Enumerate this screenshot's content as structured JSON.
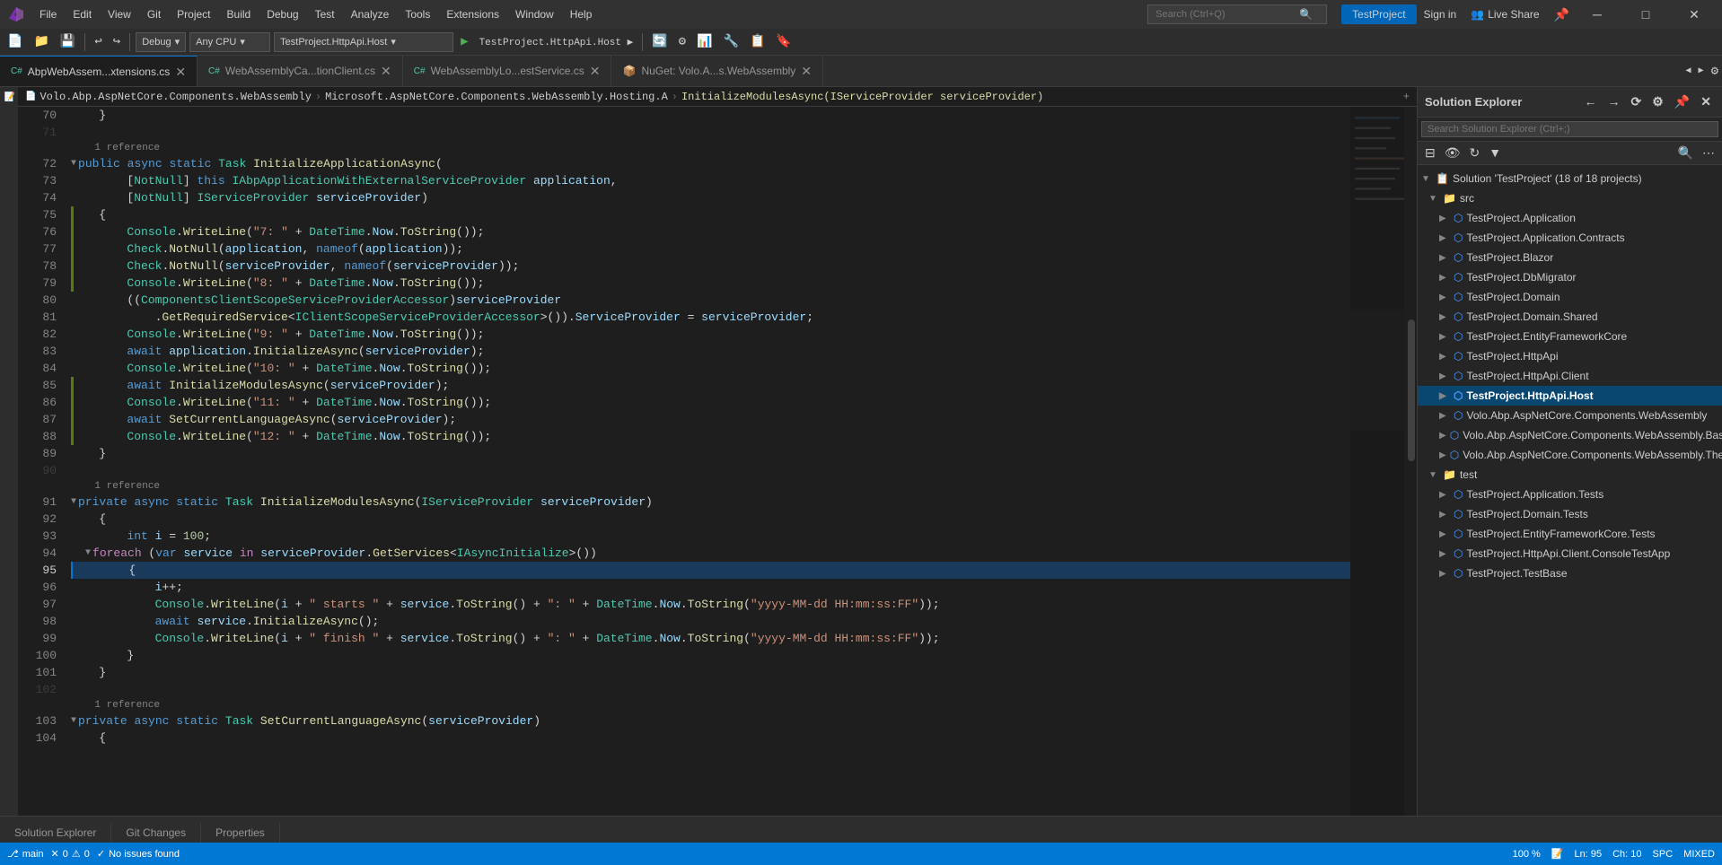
{
  "titlebar": {
    "menus": [
      "File",
      "Edit",
      "View",
      "Git",
      "Project",
      "Build",
      "Debug",
      "Test",
      "Analyze",
      "Tools",
      "Extensions",
      "Window",
      "Help"
    ],
    "search_placeholder": "Search (Ctrl+Q)",
    "project_name": "TestProject",
    "sign_in": "Sign in",
    "live_share": "Live Share"
  },
  "toolbar": {
    "debug_config": "Debug",
    "platform": "Any CPU",
    "startup_project": "TestProject.HttpApi.Host"
  },
  "tabs": [
    {
      "label": "AbpWebAssem...xtensions.cs",
      "active": true,
      "modified": false
    },
    {
      "label": "WebAssemblyCa...tionClient.cs",
      "active": false,
      "modified": false
    },
    {
      "label": "WebAssemblyLo...estService.cs",
      "active": false,
      "modified": false
    },
    {
      "label": "NuGet: Volo.A...s.WebAssembly",
      "active": false,
      "modified": false
    }
  ],
  "breadcrumb": {
    "parts": [
      "Volo.Abp.AspNetCore.Components.WebAssembly",
      "Microsoft.AspNetCore.Components.WebAssembly.Hosting.A",
      "InitializeModulesAsync(IServiceProvider serviceProvider)"
    ]
  },
  "code": {
    "lines": [
      {
        "num": "70",
        "content": "    }",
        "indent": 4
      },
      {
        "num": "",
        "content": ""
      },
      {
        "num": "72",
        "content": "    public async static Task InitializeApplicationAsync(",
        "hasRef": true,
        "refText": "1 reference"
      },
      {
        "num": "73",
        "content": "        [NotNull] this IAbpApplicationWithExternalServiceProvider application,"
      },
      {
        "num": "74",
        "content": "        [NotNull] IServiceProvider serviceProvider)"
      },
      {
        "num": "75",
        "content": "    {",
        "collapsible": true
      },
      {
        "num": "76",
        "content": "        Console.WriteLine(\"7: \" + DateTime.Now.ToString());"
      },
      {
        "num": "77",
        "content": "        Check.NotNull(application, nameof(application));"
      },
      {
        "num": "78",
        "content": "        Check.NotNull(serviceProvider, nameof(serviceProvider));"
      },
      {
        "num": "79",
        "content": "        Console.WriteLine(\"8: \" + DateTime.Now.ToString());"
      },
      {
        "num": "80",
        "content": "        ((ComponentsClientScopeServiceProviderAccessor)serviceProvider"
      },
      {
        "num": "81",
        "content": "            .GetRequiredService<IClientScopeServiceProviderAccessor>()).ServiceProvider = serviceProvider;"
      },
      {
        "num": "82",
        "content": "        Console.WriteLine(\"9: \" + DateTime.Now.ToString());"
      },
      {
        "num": "83",
        "content": "        await application.InitializeAsync(serviceProvider);"
      },
      {
        "num": "84",
        "content": "        Console.WriteLine(\"10: \" + DateTime.Now.ToString());"
      },
      {
        "num": "85",
        "content": "        await InitializeModulesAsync(serviceProvider);"
      },
      {
        "num": "86",
        "content": "        Console.WriteLine(\"11: \" + DateTime.Now.ToString());"
      },
      {
        "num": "87",
        "content": "        await SetCurrentLanguageAsync(serviceProvider);"
      },
      {
        "num": "88",
        "content": "        Console.WriteLine(\"12: \" + DateTime.Now.ToString());"
      },
      {
        "num": "89",
        "content": "    }"
      },
      {
        "num": "90",
        "content": ""
      },
      {
        "num": "91",
        "content": "    private async static Task InitializeModulesAsync(IServiceProvider serviceProvider)",
        "hasRef": true,
        "refText": "1 reference"
      },
      {
        "num": "92",
        "content": "    {",
        "collapsible": true
      },
      {
        "num": "93",
        "content": "        int i = 100;"
      },
      {
        "num": "94",
        "content": "        foreach (var service in serviceProvider.GetServices<IAsyncInitialize>())",
        "collapsible": true
      },
      {
        "num": "95",
        "content": "        {",
        "current": true
      },
      {
        "num": "96",
        "content": "            i++;"
      },
      {
        "num": "97",
        "content": "            Console.WriteLine(i + \" starts \" + service.ToString() + \": \" + DateTime.Now.ToString(\"yyyy-MM-dd HH:mm:ss:FF\"));"
      },
      {
        "num": "98",
        "content": "            await service.InitializeAsync();"
      },
      {
        "num": "99",
        "content": "            Console.WriteLine(i + \" finish \" + service.ToString() + \": \" + DateTime.Now.ToString(\"yyyy-MM-dd HH:mm:ss:FF\"));"
      },
      {
        "num": "100",
        "content": "        }"
      },
      {
        "num": "101",
        "content": "    }"
      },
      {
        "num": "102",
        "content": ""
      },
      {
        "num": "103",
        "content": "    private async static Task SetCurrentLanguageAsync(serviceProvider)",
        "hasRef": true,
        "refText": "1 reference"
      },
      {
        "num": "104",
        "content": "    {"
      }
    ]
  },
  "solution_explorer": {
    "title": "Solution Explorer",
    "search_placeholder": "Search Solution Explorer (Ctrl+;)",
    "solution_name": "Solution 'TestProject' (18 of 18 projects)",
    "items": [
      {
        "label": "src",
        "type": "folder",
        "indent": 1,
        "expanded": true
      },
      {
        "label": "TestProject.Application",
        "type": "project",
        "indent": 2
      },
      {
        "label": "TestProject.Application.Contracts",
        "type": "project",
        "indent": 2
      },
      {
        "label": "TestProject.Blazor",
        "type": "project",
        "indent": 2
      },
      {
        "label": "TestProject.DbMigrator",
        "type": "project",
        "indent": 2
      },
      {
        "label": "TestProject.Domain",
        "type": "project",
        "indent": 2
      },
      {
        "label": "TestProject.Domain.Shared",
        "type": "project",
        "indent": 2
      },
      {
        "label": "TestProject.EntityFrameworkCore",
        "type": "project",
        "indent": 2
      },
      {
        "label": "TestProject.HttpApi",
        "type": "project",
        "indent": 2
      },
      {
        "label": "TestProject.HttpApi.Client",
        "type": "project",
        "indent": 2
      },
      {
        "label": "TestProject.HttpApi.Host",
        "type": "project",
        "indent": 2,
        "active": true
      },
      {
        "label": "Volo.Abp.AspNetCore.Components.WebAssembly",
        "type": "project",
        "indent": 2
      },
      {
        "label": "Volo.Abp.AspNetCore.Components.WebAssembly.BasicTheme",
        "type": "project",
        "indent": 2
      },
      {
        "label": "Volo.Abp.AspNetCore.Components.WebAssembly.Theming",
        "type": "project",
        "indent": 2
      },
      {
        "label": "test",
        "type": "folder",
        "indent": 1,
        "expanded": true
      },
      {
        "label": "TestProject.Application.Tests",
        "type": "project",
        "indent": 2
      },
      {
        "label": "TestProject.Domain.Tests",
        "type": "project",
        "indent": 2
      },
      {
        "label": "TestProject.EntityFrameworkCore.Tests",
        "type": "project",
        "indent": 2
      },
      {
        "label": "TestProject.HttpApi.Client.ConsoleTestApp",
        "type": "project",
        "indent": 2
      },
      {
        "label": "TestProject.TestBase",
        "type": "project",
        "indent": 2
      }
    ]
  },
  "status_bar": {
    "branch": "main",
    "errors": "0",
    "warnings": "0",
    "status": "No issues found",
    "line": "Ln: 95",
    "col": "Ch: 10",
    "spaces": "SPC",
    "encoding": "MIXED",
    "zoom": "100 %"
  },
  "bottom_tabs": [
    {
      "label": "Solution Explorer",
      "active": false
    },
    {
      "label": "Git Changes",
      "active": false
    },
    {
      "label": "Properties",
      "active": false
    }
  ]
}
